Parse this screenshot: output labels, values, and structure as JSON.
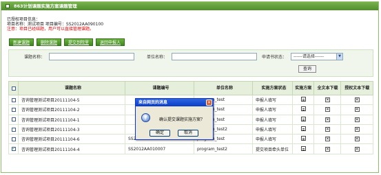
{
  "window": {
    "title": "863计划课题实施方案课题管理"
  },
  "info": {
    "line1": "已授权项目信息：",
    "line2": "项目名称：测试项目  项目编号：SS2012AA090100",
    "warning": "注意：项目已经结题，用户可以直接管理课题。"
  },
  "actions": [
    "新建课题",
    "删除课题",
    "提交到院里",
    "退回申报人"
  ],
  "search": {
    "topic_name_label": "课题名称：",
    "unit_name_label": "单位名称：",
    "status_label": "申请书状态：",
    "status_value": "------请选择------",
    "query_button": "查询"
  },
  "table": {
    "headers": [
      "课题名称",
      "课题编号",
      "单位名称",
      "实施方案状态",
      "实施方案",
      "全文本下载",
      "授权文本下载"
    ],
    "rows": [
      {
        "name": "咨询管理测试项目20111104-5",
        "code": "",
        "unit": "program_test",
        "status": "申报人填写",
        "checked": false
      },
      {
        "name": "咨询管理测试项目20111104-2",
        "code": "",
        "unit": "program_test",
        "status": "申报人填写",
        "checked": false
      },
      {
        "name": "咨询管理测试项目20111104-1",
        "code": "",
        "unit": "program_test",
        "status": "申报人填写",
        "checked": false
      },
      {
        "name": "咨询管理测试项目20111104-3",
        "code": "",
        "unit": "program_test2",
        "status": "申报人填写",
        "checked": false
      },
      {
        "name": "咨询管理测试项目20111104-6",
        "code": "SS2012AA010008",
        "unit": "program_test",
        "status": "申报人填写",
        "checked": false
      },
      {
        "name": "咨询管理测试项目20111104-4",
        "code": "SS2012AA010007",
        "unit": "program_test2",
        "status": "提交项目牵头单位",
        "checked": true
      }
    ]
  },
  "dialog": {
    "title": "来自网页的消息",
    "message": "确认提交课题实施方案？",
    "ok_label": "确定",
    "cancel_label": "取消"
  },
  "colors": {
    "accent": "#4e8f2c",
    "warning": "#e00000",
    "dialog_title": "#0a3cc7"
  }
}
